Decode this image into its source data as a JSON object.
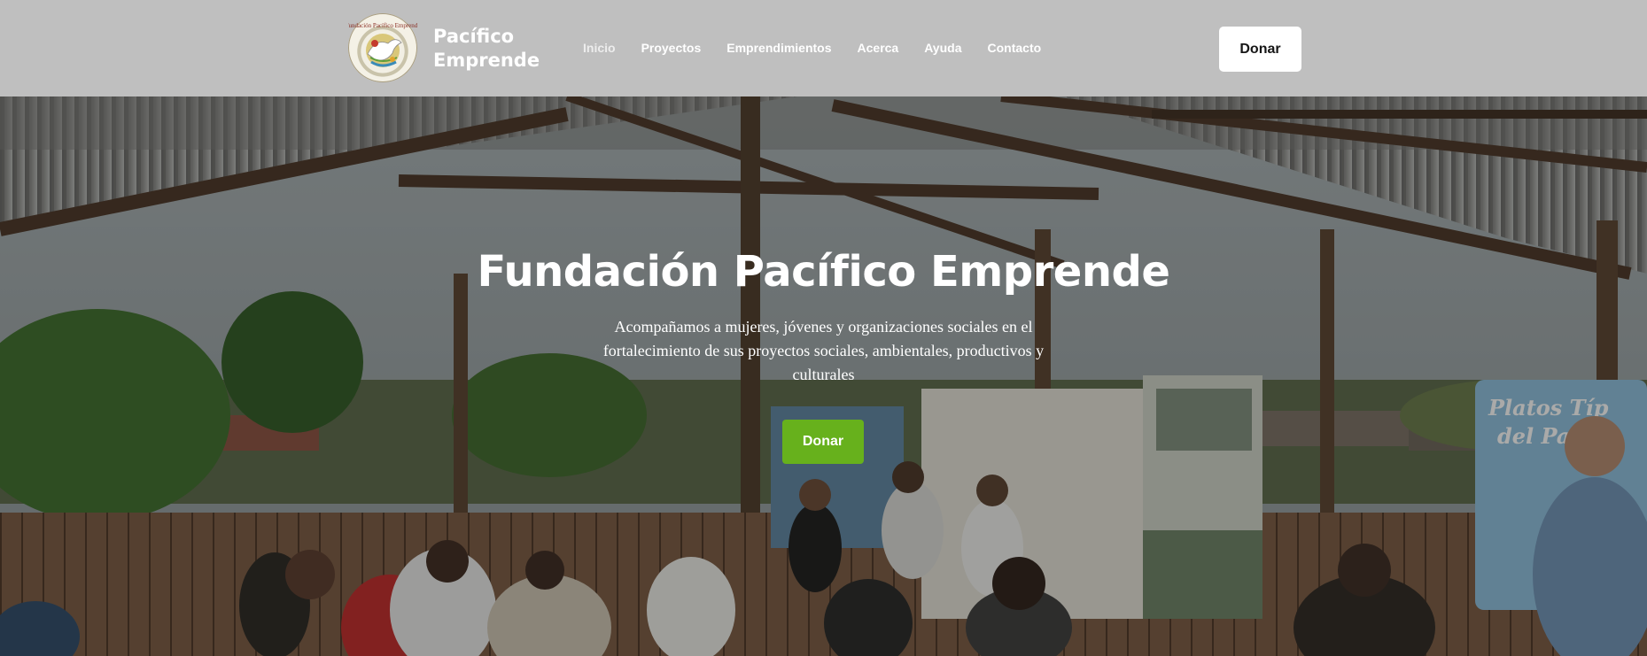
{
  "header": {
    "brand_line1": "Pacífico",
    "brand_line2": "Emprende",
    "logo_text": "Fundación Pacífico Emprende",
    "nav": [
      {
        "label": "Inicio"
      },
      {
        "label": "Proyectos"
      },
      {
        "label": "Emprendimientos"
      },
      {
        "label": "Acerca"
      },
      {
        "label": "Ayuda"
      },
      {
        "label": "Contacto"
      }
    ],
    "donate_label": "Donar"
  },
  "hero": {
    "title": "Fundación Pacífico Emprende",
    "subtitle": "Acompañamos a mujeres, jóvenes y organizaciones sociales en el fortalecimiento de sus proyectos sociales, ambientales, productivos y culturales",
    "donate_label": "Donar",
    "sign_line1": "Platos Típ",
    "sign_line2": "del Pacífi"
  },
  "colors": {
    "navbar_bg": "#bfbfbf",
    "accent_green": "#67b11c",
    "white": "#ffffff"
  }
}
